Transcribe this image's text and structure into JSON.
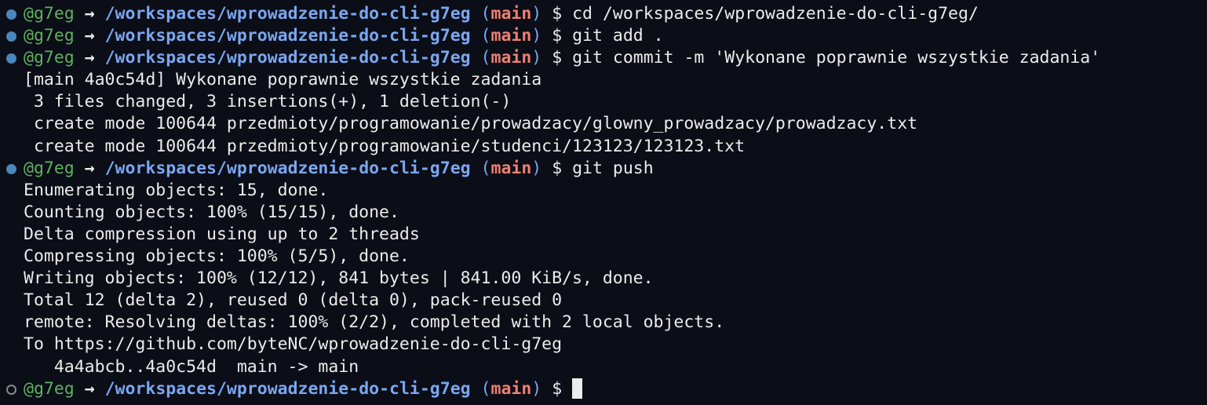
{
  "prompt": {
    "user": "@g7eg",
    "arrow": "→",
    "path": "/workspaces/wprowadzenie-do-cli-g7eg",
    "branch_open": "(",
    "branch": "main",
    "branch_close": ")",
    "symbol": "$"
  },
  "colors": {
    "background": "#0b0d17",
    "text": "#ececec",
    "user": "#5fb15f",
    "path": "#7aa7f0",
    "branch": "#f07f72",
    "status_dot": "#4c86bd"
  },
  "commands": [
    {
      "status": "done",
      "text": "cd /workspaces/wprowadzenie-do-cli-g7eg/",
      "output": []
    },
    {
      "status": "done",
      "text": "git add .",
      "output": []
    },
    {
      "status": "done",
      "text": "git commit -m 'Wykonane poprawnie wszystkie zadania'",
      "output": [
        "[main 4a0c54d] Wykonane poprawnie wszystkie zadania",
        " 3 files changed, 3 insertions(+), 1 deletion(-)",
        " create mode 100644 przedmioty/programowanie/prowadzacy/glowny_prowadzacy/prowadzacy.txt",
        " create mode 100644 przedmioty/programowanie/studenci/123123/123123.txt"
      ]
    },
    {
      "status": "done",
      "text": "git push",
      "output": [
        "Enumerating objects: 15, done.",
        "Counting objects: 100% (15/15), done.",
        "Delta compression using up to 2 threads",
        "Compressing objects: 100% (5/5), done.",
        "Writing objects: 100% (12/12), 841 bytes | 841.00 KiB/s, done.",
        "Total 12 (delta 2), reused 0 (delta 0), pack-reused 0",
        "remote: Resolving deltas: 100% (2/2), completed with 2 local objects.",
        "To https://github.com/byteNC/wprowadzenie-do-cli-g7eg",
        "   4a4abcb..4a0c54d  main -> main"
      ]
    },
    {
      "status": "pending",
      "text": "",
      "output": [],
      "cursor": true
    }
  ]
}
